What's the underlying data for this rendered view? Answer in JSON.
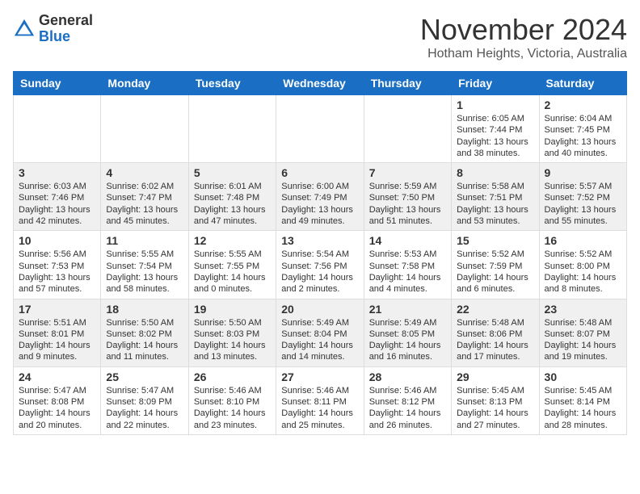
{
  "header": {
    "logo_general": "General",
    "logo_blue": "Blue",
    "month": "November 2024",
    "location": "Hotham Heights, Victoria, Australia"
  },
  "days_of_week": [
    "Sunday",
    "Monday",
    "Tuesday",
    "Wednesday",
    "Thursday",
    "Friday",
    "Saturday"
  ],
  "weeks": [
    [
      {
        "day": "",
        "info": ""
      },
      {
        "day": "",
        "info": ""
      },
      {
        "day": "",
        "info": ""
      },
      {
        "day": "",
        "info": ""
      },
      {
        "day": "",
        "info": ""
      },
      {
        "day": "1",
        "info": "Sunrise: 6:05 AM\nSunset: 7:44 PM\nDaylight: 13 hours\nand 38 minutes."
      },
      {
        "day": "2",
        "info": "Sunrise: 6:04 AM\nSunset: 7:45 PM\nDaylight: 13 hours\nand 40 minutes."
      }
    ],
    [
      {
        "day": "3",
        "info": "Sunrise: 6:03 AM\nSunset: 7:46 PM\nDaylight: 13 hours\nand 42 minutes."
      },
      {
        "day": "4",
        "info": "Sunrise: 6:02 AM\nSunset: 7:47 PM\nDaylight: 13 hours\nand 45 minutes."
      },
      {
        "day": "5",
        "info": "Sunrise: 6:01 AM\nSunset: 7:48 PM\nDaylight: 13 hours\nand 47 minutes."
      },
      {
        "day": "6",
        "info": "Sunrise: 6:00 AM\nSunset: 7:49 PM\nDaylight: 13 hours\nand 49 minutes."
      },
      {
        "day": "7",
        "info": "Sunrise: 5:59 AM\nSunset: 7:50 PM\nDaylight: 13 hours\nand 51 minutes."
      },
      {
        "day": "8",
        "info": "Sunrise: 5:58 AM\nSunset: 7:51 PM\nDaylight: 13 hours\nand 53 minutes."
      },
      {
        "day": "9",
        "info": "Sunrise: 5:57 AM\nSunset: 7:52 PM\nDaylight: 13 hours\nand 55 minutes."
      }
    ],
    [
      {
        "day": "10",
        "info": "Sunrise: 5:56 AM\nSunset: 7:53 PM\nDaylight: 13 hours\nand 57 minutes."
      },
      {
        "day": "11",
        "info": "Sunrise: 5:55 AM\nSunset: 7:54 PM\nDaylight: 13 hours\nand 58 minutes."
      },
      {
        "day": "12",
        "info": "Sunrise: 5:55 AM\nSunset: 7:55 PM\nDaylight: 14 hours\nand 0 minutes."
      },
      {
        "day": "13",
        "info": "Sunrise: 5:54 AM\nSunset: 7:56 PM\nDaylight: 14 hours\nand 2 minutes."
      },
      {
        "day": "14",
        "info": "Sunrise: 5:53 AM\nSunset: 7:58 PM\nDaylight: 14 hours\nand 4 minutes."
      },
      {
        "day": "15",
        "info": "Sunrise: 5:52 AM\nSunset: 7:59 PM\nDaylight: 14 hours\nand 6 minutes."
      },
      {
        "day": "16",
        "info": "Sunrise: 5:52 AM\nSunset: 8:00 PM\nDaylight: 14 hours\nand 8 minutes."
      }
    ],
    [
      {
        "day": "17",
        "info": "Sunrise: 5:51 AM\nSunset: 8:01 PM\nDaylight: 14 hours\nand 9 minutes."
      },
      {
        "day": "18",
        "info": "Sunrise: 5:50 AM\nSunset: 8:02 PM\nDaylight: 14 hours\nand 11 minutes."
      },
      {
        "day": "19",
        "info": "Sunrise: 5:50 AM\nSunset: 8:03 PM\nDaylight: 14 hours\nand 13 minutes."
      },
      {
        "day": "20",
        "info": "Sunrise: 5:49 AM\nSunset: 8:04 PM\nDaylight: 14 hours\nand 14 minutes."
      },
      {
        "day": "21",
        "info": "Sunrise: 5:49 AM\nSunset: 8:05 PM\nDaylight: 14 hours\nand 16 minutes."
      },
      {
        "day": "22",
        "info": "Sunrise: 5:48 AM\nSunset: 8:06 PM\nDaylight: 14 hours\nand 17 minutes."
      },
      {
        "day": "23",
        "info": "Sunrise: 5:48 AM\nSunset: 8:07 PM\nDaylight: 14 hours\nand 19 minutes."
      }
    ],
    [
      {
        "day": "24",
        "info": "Sunrise: 5:47 AM\nSunset: 8:08 PM\nDaylight: 14 hours\nand 20 minutes."
      },
      {
        "day": "25",
        "info": "Sunrise: 5:47 AM\nSunset: 8:09 PM\nDaylight: 14 hours\nand 22 minutes."
      },
      {
        "day": "26",
        "info": "Sunrise: 5:46 AM\nSunset: 8:10 PM\nDaylight: 14 hours\nand 23 minutes."
      },
      {
        "day": "27",
        "info": "Sunrise: 5:46 AM\nSunset: 8:11 PM\nDaylight: 14 hours\nand 25 minutes."
      },
      {
        "day": "28",
        "info": "Sunrise: 5:46 AM\nSunset: 8:12 PM\nDaylight: 14 hours\nand 26 minutes."
      },
      {
        "day": "29",
        "info": "Sunrise: 5:45 AM\nSunset: 8:13 PM\nDaylight: 14 hours\nand 27 minutes."
      },
      {
        "day": "30",
        "info": "Sunrise: 5:45 AM\nSunset: 8:14 PM\nDaylight: 14 hours\nand 28 minutes."
      }
    ]
  ]
}
